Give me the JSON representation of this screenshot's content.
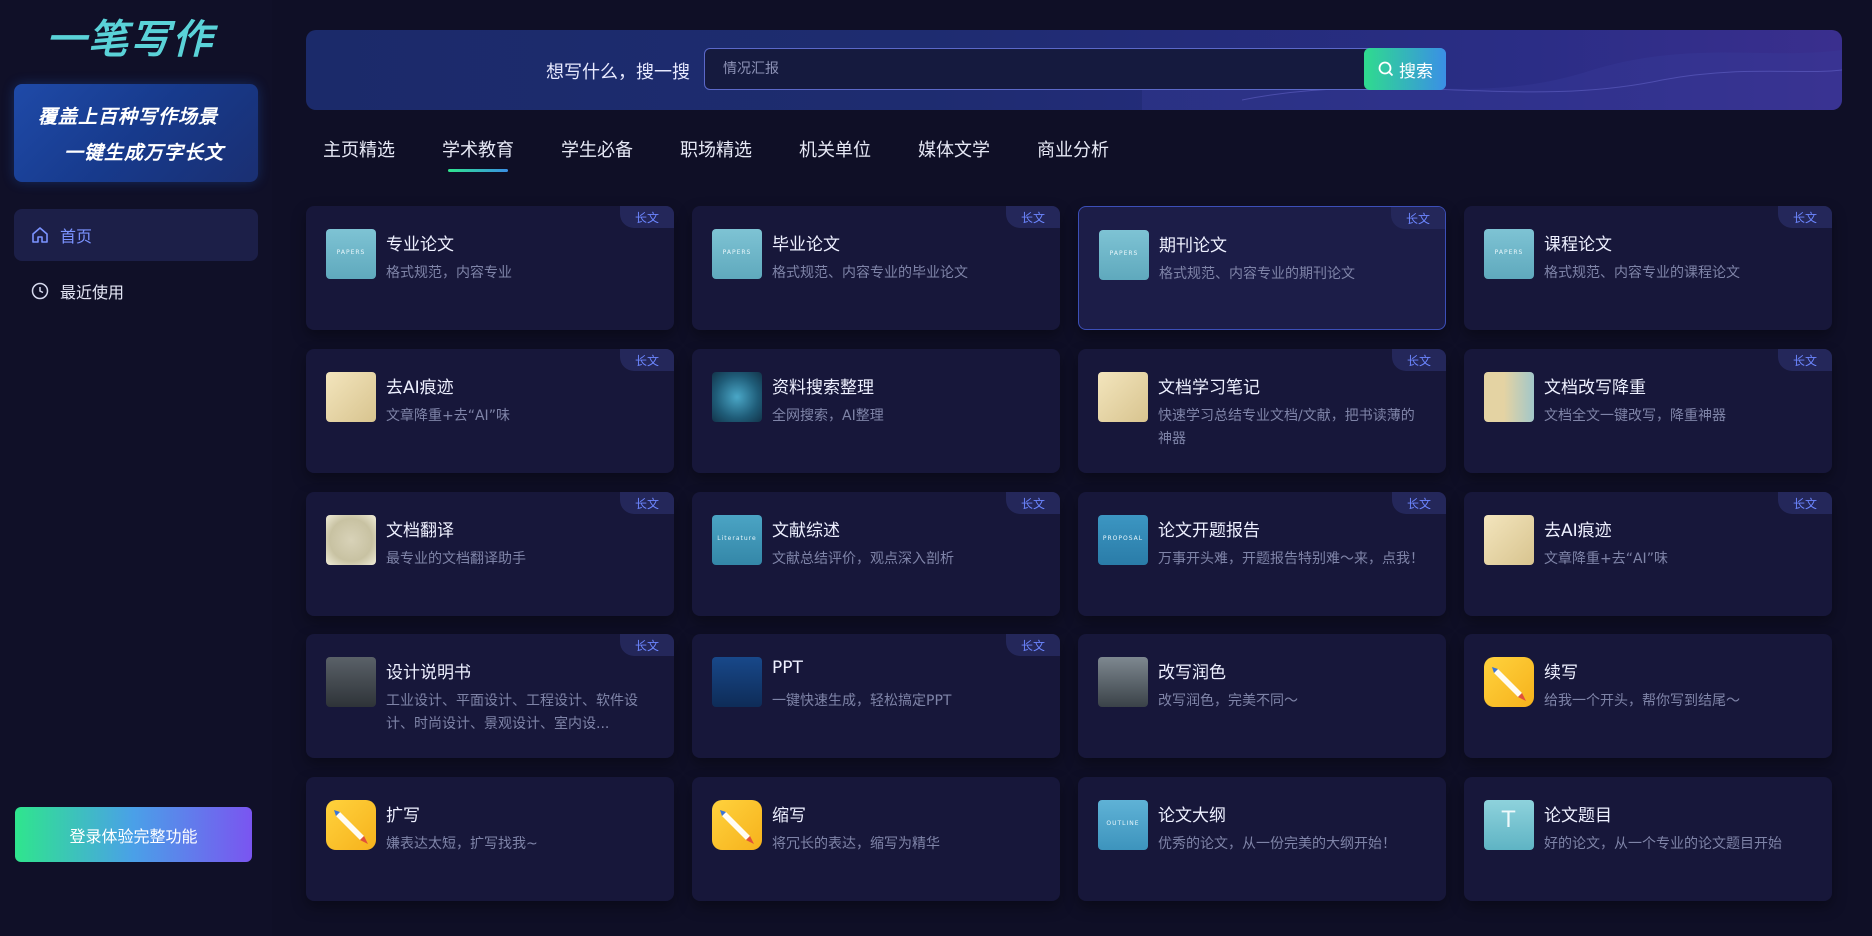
{
  "brand": {
    "logo_text": "一笔写作"
  },
  "banner": {
    "line1": "覆盖上百种写作场景",
    "line2": "一键生成万字长文"
  },
  "sidebar": {
    "items": [
      {
        "label": "首页",
        "icon": "home-icon",
        "active": true
      },
      {
        "label": "最近使用",
        "icon": "clock-icon",
        "active": false
      }
    ],
    "login_label": "登录体验完整功能"
  },
  "search": {
    "label": "想写什么，搜一搜",
    "placeholder": "情况汇报",
    "button_label": "搜索"
  },
  "tabs": [
    {
      "label": "主页精选",
      "active": false
    },
    {
      "label": "学术教育",
      "active": true
    },
    {
      "label": "学生必备",
      "active": false
    },
    {
      "label": "职场精选",
      "active": false
    },
    {
      "label": "机关单位",
      "active": false
    },
    {
      "label": "媒体文学",
      "active": false
    },
    {
      "label": "商业分析",
      "active": false
    }
  ],
  "cards": [
    {
      "title": "专业论文",
      "desc": "格式规范，内容专业",
      "tag": "长文",
      "thumb": "paper",
      "thumb_text": "PAPERS"
    },
    {
      "title": "毕业论文",
      "desc": "格式规范、内容专业的毕业论文",
      "tag": "长文",
      "thumb": "paper",
      "thumb_text": "PAPERS"
    },
    {
      "title": "期刊论文",
      "desc": "格式规范、内容专业的期刊论文",
      "tag": "长文",
      "thumb": "paper",
      "thumb_text": "PAPERS"
    },
    {
      "title": "课程论文",
      "desc": "格式规范、内容专业的课程论文",
      "tag": "长文",
      "thumb": "paper",
      "thumb_text": "PAPERS"
    },
    {
      "title": "去AI痕迹",
      "desc": "文章降重+去“AI”味",
      "tag": "长文",
      "thumb": "beige",
      "thumb_text": ""
    },
    {
      "title": "资料搜索整理",
      "desc": "全网搜索，AI整理",
      "tag": "",
      "thumb": "net",
      "thumb_text": ""
    },
    {
      "title": "文档学习笔记",
      "desc": "快速学习总结专业文档/文献，把书读薄的神器",
      "tag": "长文",
      "thumb": "beige",
      "thumb_text": ""
    },
    {
      "title": "文档改写降重",
      "desc": "文档全文一键改写，降重神器",
      "tag": "长文",
      "thumb": "doc",
      "thumb_text": ""
    },
    {
      "title": "文档翻译",
      "desc": "最专业的文档翻译助手",
      "tag": "长文",
      "thumb": "map",
      "thumb_text": ""
    },
    {
      "title": "文献综述",
      "desc": "文献总结评价，观点深入剖析",
      "tag": "长文",
      "thumb": "lit",
      "thumb_text": "Literature"
    },
    {
      "title": "论文开题报告",
      "desc": "万事开头难，开题报告特别难～来，点我！",
      "tag": "长文",
      "thumb": "prop",
      "thumb_text": "PROPOSAL"
    },
    {
      "title": "去AI痕迹",
      "desc": "文章降重+去“AI”味",
      "tag": "长文",
      "thumb": "beige",
      "thumb_text": ""
    },
    {
      "title": "设计说明书",
      "desc": "工业设计、平面设计、工程设计、软件设计、时尚设计、景观设计、室内设...",
      "tag": "长文",
      "thumb": "room",
      "thumb_text": ""
    },
    {
      "title": "PPT",
      "desc": "一键快速生成，轻松搞定PPT",
      "tag": "长文",
      "thumb": "ppt",
      "thumb_text": ""
    },
    {
      "title": "改写润色",
      "desc": "改写润色，完美不同～",
      "tag": "",
      "thumb": "robot",
      "thumb_text": ""
    },
    {
      "title": "续写",
      "desc": "给我一个开头，帮你写到结尾～",
      "tag": "",
      "thumb": "pen",
      "thumb_text": ""
    },
    {
      "title": "扩写",
      "desc": "嫌表达太短，扩写找我~",
      "tag": "",
      "thumb": "pen",
      "thumb_text": ""
    },
    {
      "title": "缩写",
      "desc": "将冗长的表达，缩写为精华",
      "tag": "",
      "thumb": "pen",
      "thumb_text": ""
    },
    {
      "title": "论文大纲",
      "desc": "优秀的论文，从一份完美的大纲开始！",
      "tag": "",
      "thumb": "outline",
      "thumb_text": "OUTLINE"
    },
    {
      "title": "论文题目",
      "desc": "好的论文，从一个专业的论文题目开始",
      "tag": "",
      "thumb": "t",
      "thumb_text": "T"
    }
  ],
  "highlighted_card_index": 2,
  "colors": {
    "accent": "#7b93ff",
    "tag_text": "#6c86ff",
    "background": "#0f0f26"
  }
}
